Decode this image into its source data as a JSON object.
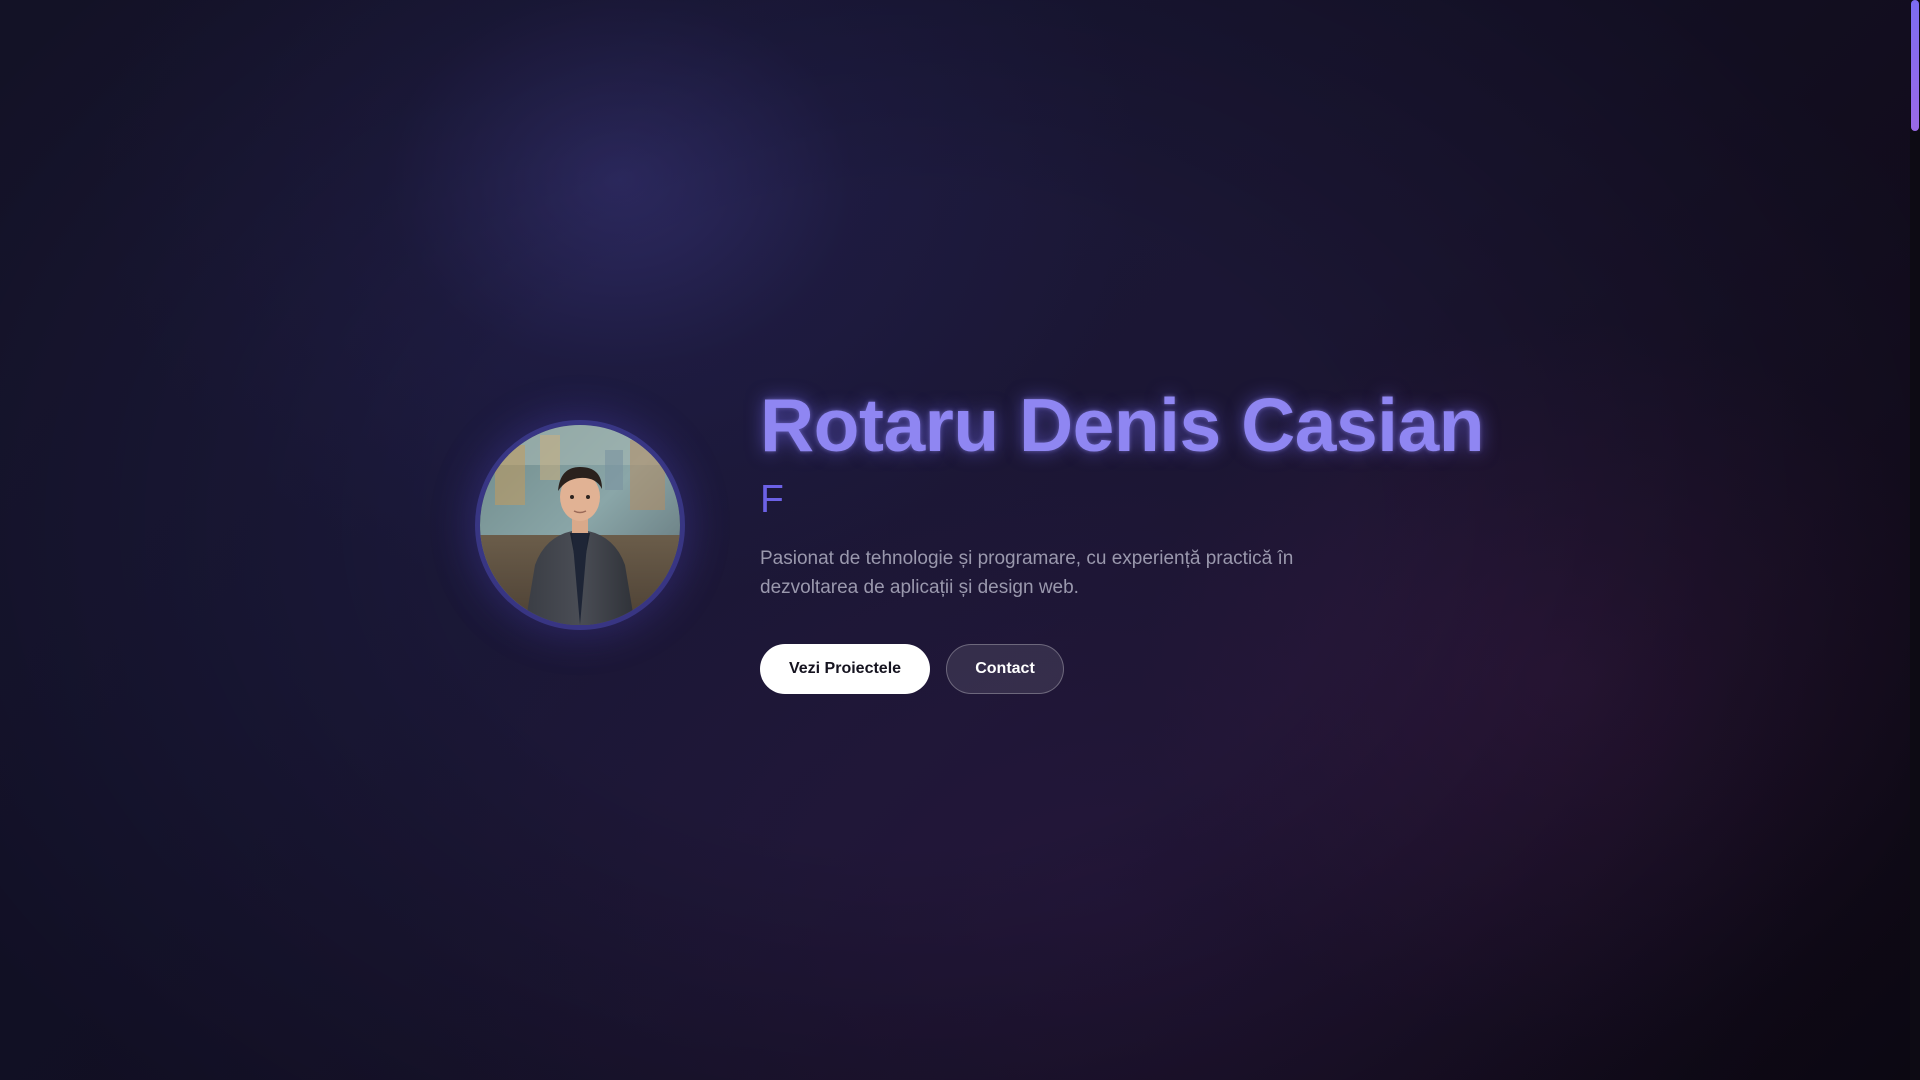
{
  "hero": {
    "name": "Rotaru Denis Casian",
    "typing_text": "F",
    "description": "Pasionat de tehnologie și programare, cu experiență practică în dezvoltarea de aplicații și design web.",
    "primary_button": "Vezi Proiectele",
    "secondary_button": "Contact",
    "avatar_icon": "profile-photo"
  },
  "colors": {
    "name_accent": "#8f86f2",
    "typing_accent": "#6c61e6",
    "scrollbar_thumb": "#8a6cee",
    "background": "#1b1836"
  }
}
